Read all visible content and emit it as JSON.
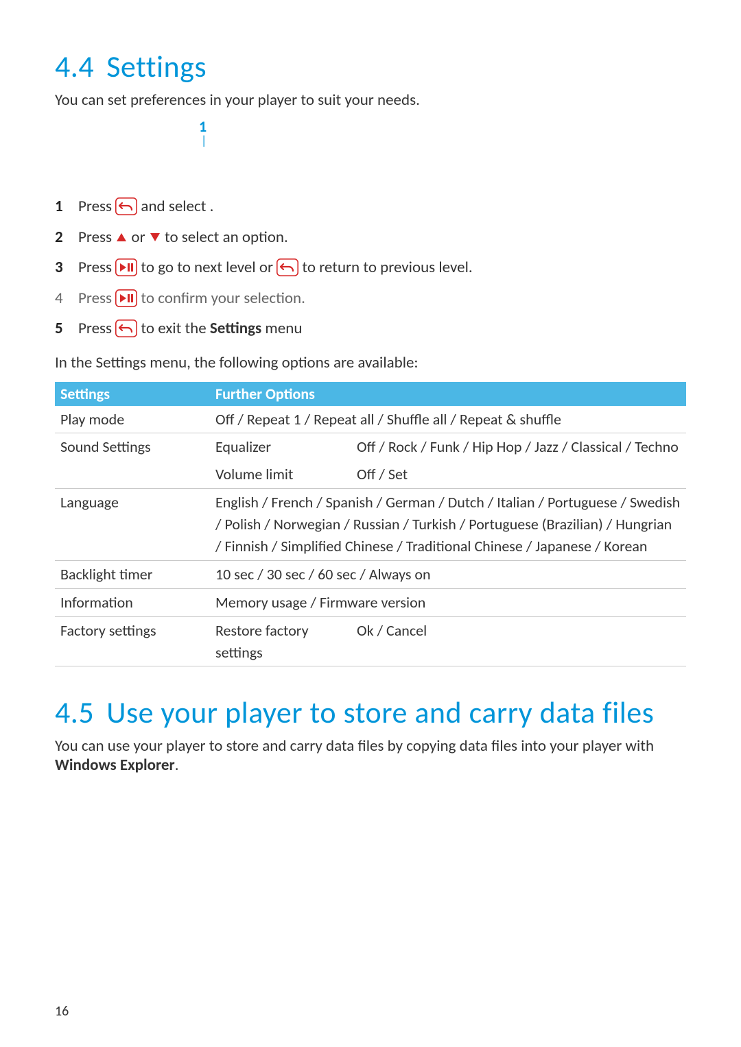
{
  "section44": {
    "num": "4.4",
    "title": "Settings",
    "lead": "You can set preferences in your player to suit your needs.",
    "callout": "1",
    "steps": [
      {
        "n": "1",
        "pre": "Press ",
        "icon1": "back",
        "mid": " and select ",
        "post": "."
      },
      {
        "n": "2",
        "pre": "Press ",
        "icon1": "up",
        "mid": " or ",
        "icon2": "down",
        "post": " to select an option."
      },
      {
        "n": "3",
        "pre": "Press ",
        "icon1": "playpause",
        "mid": " to go to next level or ",
        "icon2": "back",
        "post": " to return to previous level."
      },
      {
        "n": "4",
        "soft": true,
        "pre": "Press ",
        "icon1": "playpause",
        "post": " to confirm your selection."
      },
      {
        "n": "5",
        "pre": "Press ",
        "icon1": "back",
        "mid": " to exit the ",
        "boldword": "Settings",
        "post": " menu"
      }
    ],
    "intro2": "In the Settings menu, the following options are available:",
    "table": {
      "head1": "Settings",
      "head2": "Further Options",
      "rows": [
        {
          "c1": "Play mode",
          "c2span": "Off / Repeat 1 / Repeat all / Shuffle all / Repeat & shuffle"
        },
        {
          "c1": "Sound Settings",
          "c2": "Equalizer",
          "c3": "Off / Rock / Funk / Hip Hop / Jazz / Classical / Techno",
          "nobb": true
        },
        {
          "c1": "",
          "c2": "Volume limit",
          "c3": "Off / Set"
        },
        {
          "c1": "Language",
          "c2span": "English / French / Spanish / German / Dutch / Italian / Portuguese / Swedish / Polish / Norwegian / Russian / Turkish / Portuguese (Brazilian) / Hungrian / Finnish / Simplified Chinese / Traditional Chinese / Japanese / Korean"
        },
        {
          "c1": "Backlight timer",
          "c2span": "10 sec / 30 sec / 60 sec / Always on"
        },
        {
          "c1": "Information",
          "c2span": "Memory usage / Firmware version"
        },
        {
          "c1": "Factory settings",
          "c2": "Restore factory settings",
          "c3": "Ok / Cancel"
        }
      ]
    }
  },
  "section45": {
    "num": "4.5",
    "title": "Use your player to store and carry data files",
    "body_pre": "You can use your player to store and carry data files by copying data files into your player with ",
    "body_bold": "Windows Explorer",
    "body_post": "."
  },
  "page_number": "16"
}
